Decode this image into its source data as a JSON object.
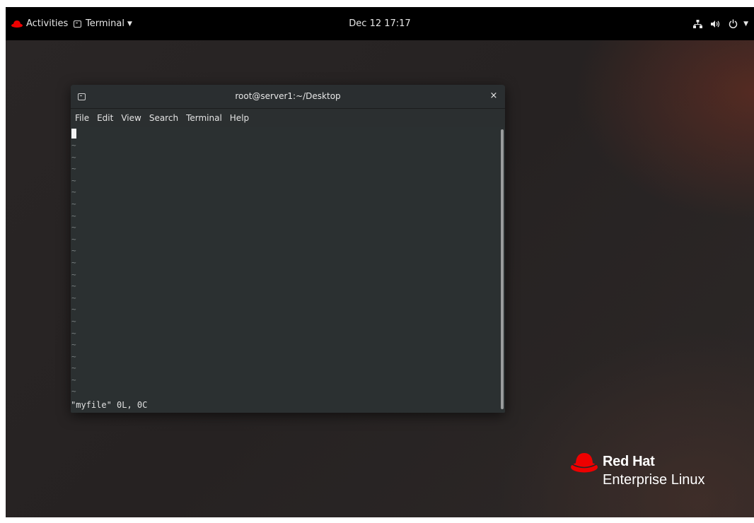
{
  "topbar": {
    "activities_label": "Activities",
    "app_menu_label": "Terminal",
    "clock": "Dec 12 17:17",
    "icons": [
      "red-hat-icon",
      "terminal-icon",
      "network-icon",
      "volume-icon",
      "power-icon",
      "chevron-down-icon"
    ]
  },
  "terminal": {
    "title": "root@server1:~/Desktop",
    "close_symbol": "×",
    "menu": [
      "File",
      "Edit",
      "View",
      "Search",
      "Terminal",
      "Help"
    ],
    "empty_line_marker": "~",
    "status_line": "\"myfile\" 0L, 0C"
  },
  "brand": {
    "line1": "Red Hat",
    "line2": "Enterprise Linux"
  },
  "colors": {
    "topbar_bg": "#000000",
    "terminal_bg": "#2b3031",
    "redhat_red": "#ee0000"
  }
}
